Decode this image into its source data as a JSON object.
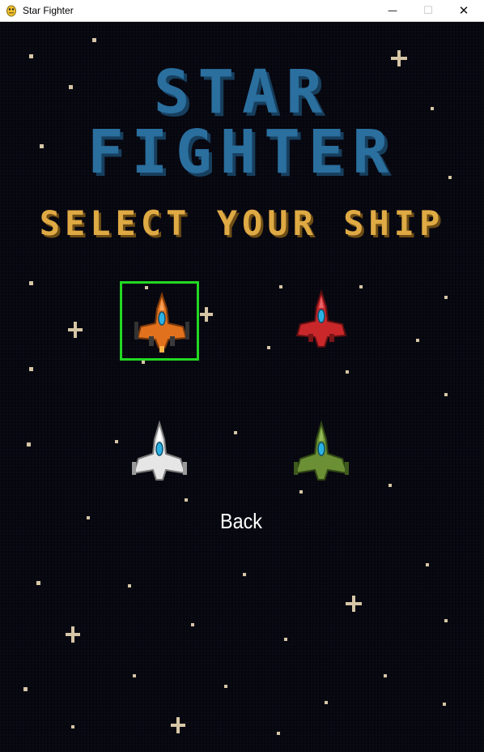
{
  "window": {
    "title": "Star Fighter",
    "minimize_glyph": "—",
    "maximize_glyph": "☐",
    "close_glyph": "✕"
  },
  "menu": {
    "title_line_1": "STAR",
    "title_line_2": "FIGHTER",
    "subtitle": "SELECT YOUR SHIP",
    "back_label": "Back"
  },
  "ships": [
    {
      "name": "orange",
      "color": "#e2711d",
      "selected": true
    },
    {
      "name": "red",
      "color": "#c9272a",
      "selected": false
    },
    {
      "name": "white",
      "color": "#e6e6e6",
      "selected": false
    },
    {
      "name": "green",
      "color": "#6b8f34",
      "selected": false
    }
  ],
  "colors": {
    "background": "#05050e",
    "title": "#2a6f9e",
    "subtitle": "#dfaa44",
    "selection": "#22d822",
    "star": "#d6c6a6"
  }
}
